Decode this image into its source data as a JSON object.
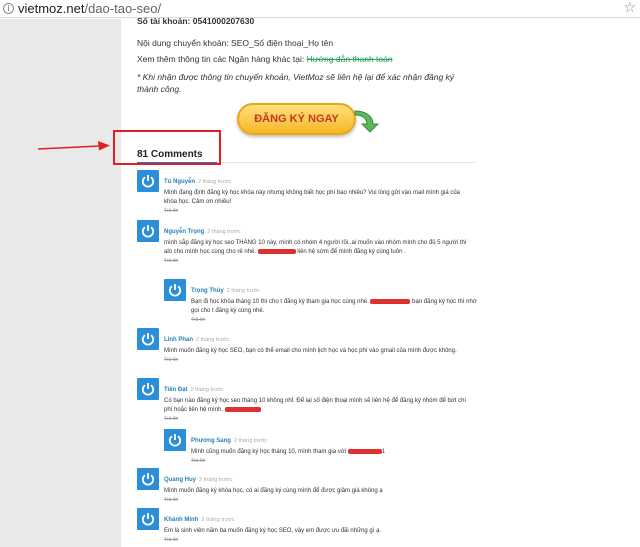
{
  "browser": {
    "url_domain": "vietmoz.net",
    "url_path": "/dao-tao-seo/"
  },
  "payment": {
    "bank_line": "Số tài khoản: 0541000207630",
    "transfer_note": "Nội dung chuyển khoản: SEO_Số điện thoại_Họ tên",
    "more_banks_prefix": "Xem thêm thông tin các Ngân hàng khác tại:",
    "more_banks_link": "Hướng dẫn thanh toán",
    "notice": "* Khi nhận được thông tin chuyển khoản, VietMoz sẽ liên hệ lại để xác nhận đăng ký thành công."
  },
  "cta": {
    "label": "ĐĂNG KÝ NGAY"
  },
  "comments_section": {
    "heading": "81 Comments"
  },
  "comments": [
    {
      "author": "Tú Nguyễn",
      "time": "2 tháng trước",
      "text": "Mình đang định đăng ký học khóa này nhưng không biết học phí bao nhiêu? Vui lòng gửi vào mail mình giá của khóa học. Cảm ơn nhiều!",
      "reply": "Trả lời"
    },
    {
      "author": "Nguyễn Trọng",
      "time": "2 tháng trước",
      "text_a": "mình sắp đăng ký học seo THÁNG 10 này, mình có nhóm 4 người rồi..ai muốn vào nhóm mình cho đủ 5 người thì alo cho mình học cùng cho rẻ nhé.",
      "text_b": "liên hệ sớm để mình đăng ký cùng luôn .",
      "reply": "Trả lời"
    },
    {
      "author": "Trọng Thủy",
      "time": "2 tháng trước",
      "text_a": "Bạn đi học khóa tháng 10 thì cho t đăng ký tham gia học cùng nhé.",
      "text_b": "bạn đăng ký học thì nhớ gọi cho t đăng ký cùng nhé.",
      "reply": "Trả lời"
    },
    {
      "author": "Linh Phan",
      "time": "2 tháng trước",
      "text": "Mình muốn đăng ký học SEO, bạn có thể email cho mình lịch học và học phí vào gmail của mình được không.",
      "reply": "Trả lời"
    },
    {
      "author": "Tiến Đạt",
      "time": "2 tháng trước",
      "text_a": "Có bạn nào đăng ký học seo tháng 10 không nhỉ. Để lại số điện thoại mình sẽ liên hệ để đăng ký nhóm để bớt chi phí hoặc liên hệ mình.",
      "reply": "Trả lời"
    },
    {
      "author": "Phương Sang",
      "time": "2 tháng trước",
      "text_a": "Mình cũng muốn đăng ký học tháng 10, mình tham gia với",
      "text_b": "1",
      "reply": "Trả lời"
    },
    {
      "author": "Quang Huy",
      "time": "2 tháng trước",
      "text": "Mình muốn đăng ký khóa học, có ai đăng ký cùng mình để được giảm giá không ạ",
      "reply": "Trả lời"
    },
    {
      "author": "Khánh Minh",
      "time": "2 tháng trước",
      "text": "Em là sinh viên năm ba muốn đăng ký học SEO, vậy em được ưu đãi những gì ạ.",
      "reply": "Trả lời"
    }
  ],
  "colors": {
    "annotation": "#e02020",
    "avatar": "#2b8ed8",
    "author": "#2980b9"
  },
  "icons": {
    "avatar": "power-icon",
    "site_info": "info-icon",
    "bookmark": "star-icon"
  }
}
